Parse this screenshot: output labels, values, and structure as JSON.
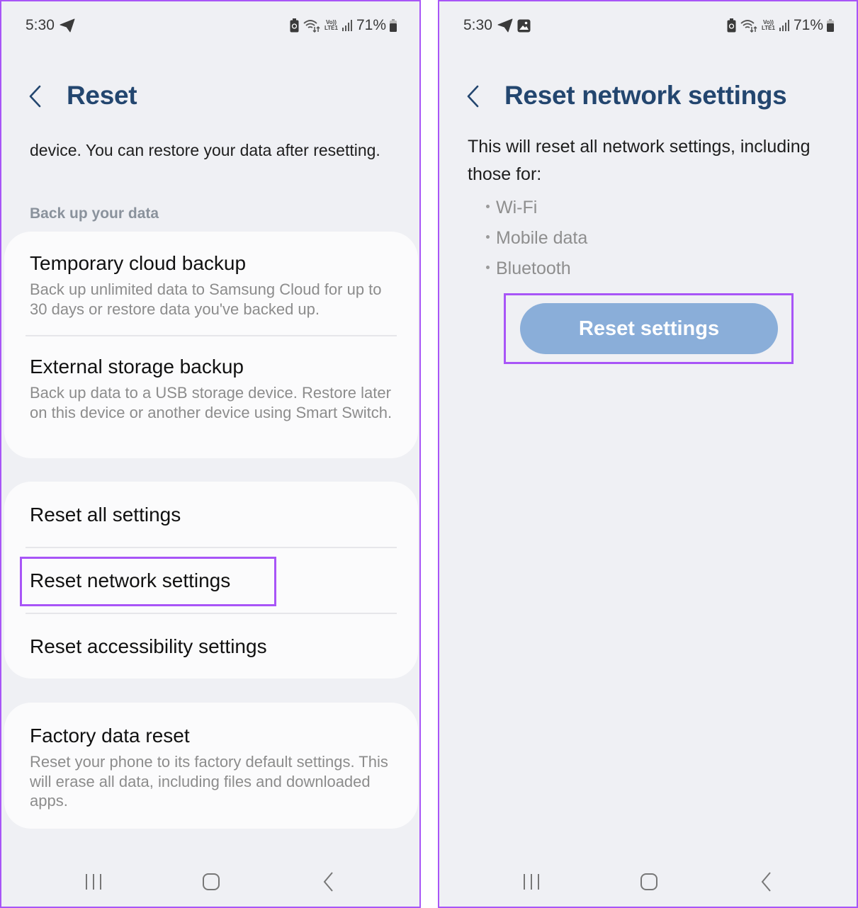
{
  "colors": {
    "title": "#23466f",
    "highlight": "#a855f7",
    "button_bg": "#8aaed9",
    "background": "#eff0f4",
    "card": "#fbfbfc"
  },
  "left_screen": {
    "status_bar": {
      "time": "5:30",
      "notification_icons": [
        "telegram-icon"
      ],
      "right_icons": [
        "battery-saver-icon",
        "wifi-icon",
        "volte-lte-icon",
        "signal-icon"
      ],
      "volte_top": "Vo))",
      "volte_bottom": "LTE1",
      "battery_percent": "71%"
    },
    "header": {
      "back_icon": "chevron-left-icon",
      "title": "Reset"
    },
    "intro_text": "device. You can restore your data after resetting.",
    "section_label": "Back up your data",
    "backup_items": [
      {
        "title": "Temporary cloud backup",
        "subtitle": "Back up unlimited data to Samsung Cloud for up to 30 days or restore data you've backed up."
      },
      {
        "title": "External storage backup",
        "subtitle": "Back up data to a USB storage device. Restore later on this device or another device using Smart Switch."
      }
    ],
    "reset_items": [
      {
        "title": "Reset all settings"
      },
      {
        "title": "Reset network settings",
        "highlighted": true
      },
      {
        "title": "Reset accessibility settings"
      }
    ],
    "factory_item": {
      "title": "Factory data reset",
      "subtitle": "Reset your phone to its factory default settings. This will erase all data, including files and downloaded apps."
    },
    "nav": [
      "recent-apps-icon",
      "home-icon",
      "back-icon"
    ]
  },
  "right_screen": {
    "status_bar": {
      "time": "5:30",
      "notification_icons": [
        "telegram-icon",
        "gallery-icon"
      ],
      "right_icons": [
        "battery-saver-icon",
        "wifi-icon",
        "volte-lte-icon",
        "signal-icon"
      ],
      "volte_top": "Vo))",
      "volte_bottom": "LTE1",
      "battery_percent": "71%"
    },
    "header": {
      "back_icon": "chevron-left-icon",
      "title": "Reset network settings"
    },
    "description": "This will reset all network settings, including those for:",
    "bullets": [
      "Wi-Fi",
      "Mobile data",
      "Bluetooth"
    ],
    "button_label": "Reset settings",
    "button_highlighted": true,
    "nav": [
      "recent-apps-icon",
      "home-icon",
      "back-icon"
    ]
  }
}
